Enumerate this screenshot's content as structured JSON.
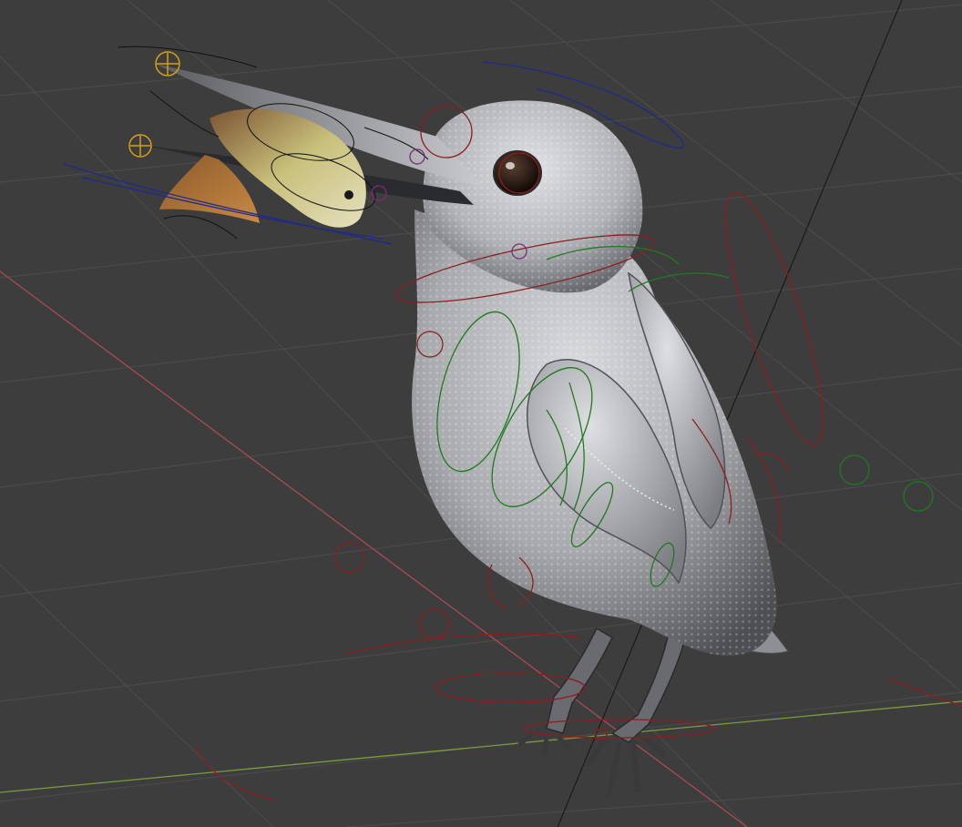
{
  "viewport": {
    "mode": "3d-viewport",
    "background_color": "#3d3d3d",
    "grid_color": "#4a4a4a",
    "x_axis_color": "#a84b55",
    "y_axis_color": "#7d9a3c",
    "z_axis_color": "#1a1a1a"
  },
  "scene": {
    "model": "kingfisher-bird",
    "held_object": "fish",
    "body_color": "#a8a9ad",
    "rig_controls": {
      "red_color": "#8b1e1e",
      "green_color": "#1f7a1f",
      "blue_color": "#1f2a8c",
      "yellow_color": "#d4a017",
      "purple_color": "#7a2a7a",
      "black_color": "#111111"
    }
  }
}
